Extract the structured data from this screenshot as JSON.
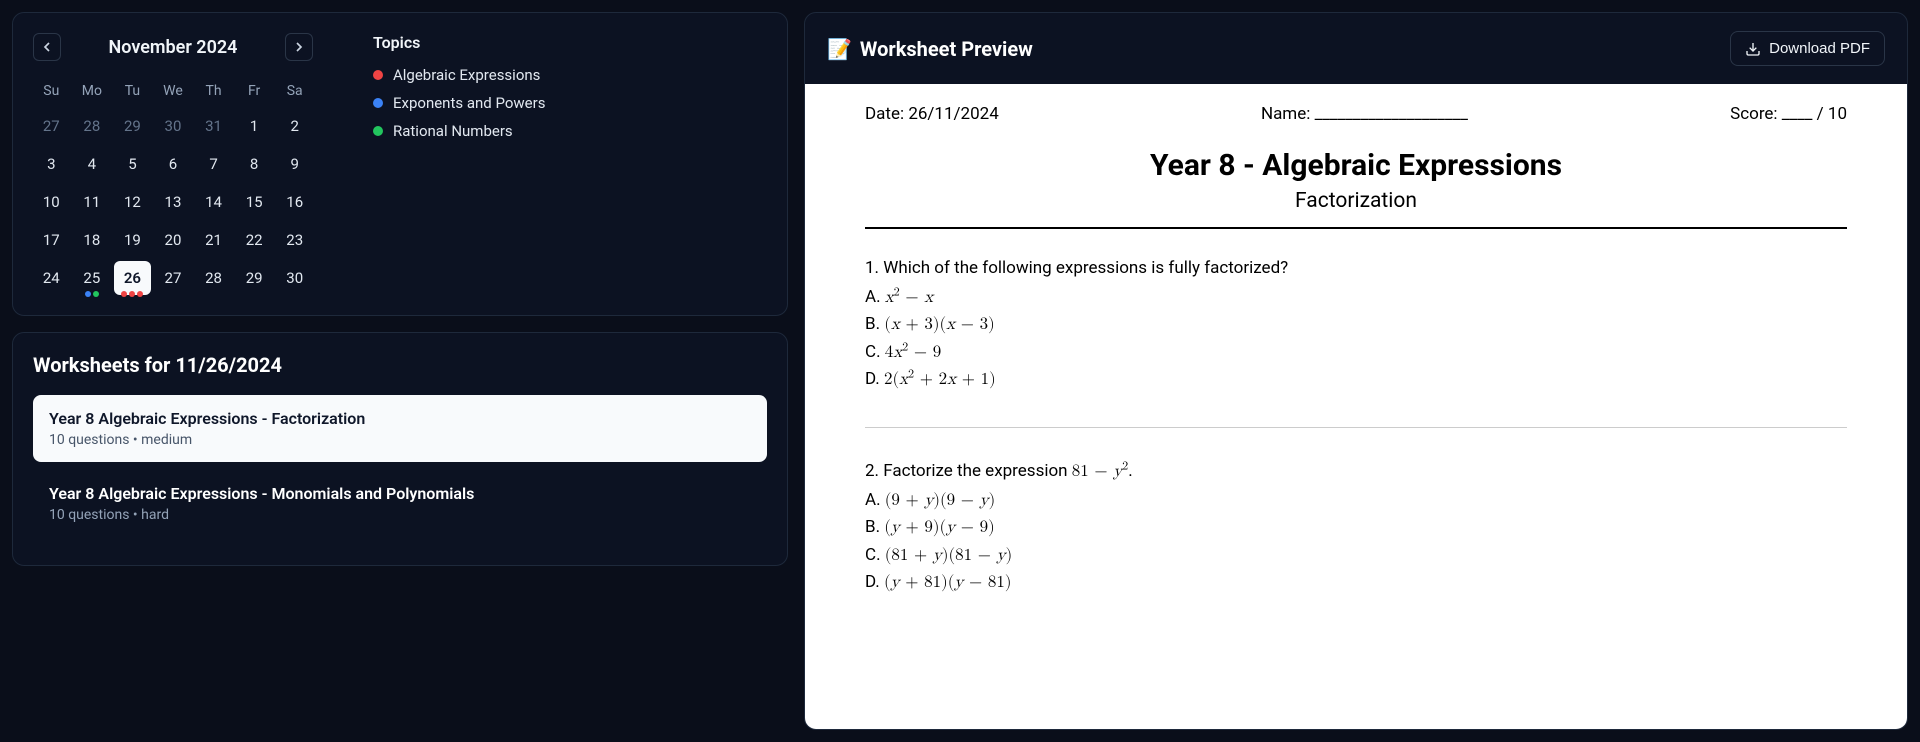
{
  "calendar": {
    "title": "November 2024",
    "dow": [
      "Su",
      "Mo",
      "Tu",
      "We",
      "Th",
      "Fr",
      "Sa"
    ],
    "prev_days": [
      "27",
      "28",
      "29",
      "30",
      "31"
    ],
    "days": [
      "1",
      "2",
      "3",
      "4",
      "5",
      "6",
      "7",
      "8",
      "9",
      "10",
      "11",
      "12",
      "13",
      "14",
      "15",
      "16",
      "17",
      "18",
      "19",
      "20",
      "21",
      "22",
      "23",
      "24",
      "25",
      "26",
      "27",
      "28",
      "29",
      "30"
    ],
    "selected": "26",
    "day_dots": {
      "25": [
        "#3b82f6",
        "#22c55e"
      ],
      "26": [
        "#ef4444",
        "#ef4444",
        "#ef4444"
      ]
    }
  },
  "topics": {
    "heading": "Topics",
    "items": [
      {
        "label": "Algebraic Expressions",
        "color": "#ef4444"
      },
      {
        "label": "Exponents and Powers",
        "color": "#3b82f6"
      },
      {
        "label": "Rational Numbers",
        "color": "#22c55e"
      }
    ]
  },
  "worksheets": {
    "heading": "Worksheets for 11/26/2024",
    "items": [
      {
        "title": "Year 8 Algebraic Expressions - Factorization",
        "meta": "10 questions  •  medium",
        "selected": true
      },
      {
        "title": "Year 8 Algebraic Expressions - Monomials and Polynomials",
        "meta": "10 questions  •  hard",
        "selected": false
      }
    ]
  },
  "preview": {
    "header_icon": "📝",
    "header_title": "Worksheet Preview",
    "download_label": "Download PDF",
    "doc": {
      "date_label": "Date: 26/11/2024",
      "name_label": "Name: ____________________",
      "score_label": "Score: ____ / 10",
      "title": "Year 8 - Algebraic Expressions",
      "subtitle": "Factorization",
      "questions": [
        {
          "text": "1. Which of the following expressions is fully factorized?",
          "options": [
            "A. <span class='math'><i>x</i><sup>2</sup> − <i>x</i></span>",
            "B. <span class='math'>(<i>x</i> + 3)(<i>x</i> − 3)</span>",
            "C. <span class='math'>4<i>x</i><sup>2</sup> − 9</span>",
            "D. <span class='math'>2(<i>x</i><sup>2</sup> + 2<i>x</i> + 1)</span>"
          ]
        },
        {
          "text": "2. Factorize the expression <span class='math'>81 − <i>y</i><sup>2</sup></span>.",
          "options": [
            "A. <span class='math'>(9 + <i>y</i>)(9 − <i>y</i>)</span>",
            "B. <span class='math'>(<i>y</i> + 9)(<i>y</i> − 9)</span>",
            "C. <span class='math'>(81 + <i>y</i>)(81 − <i>y</i>)</span>",
            "D. <span class='math'>(<i>y</i> + 81)(<i>y</i> − 81)</span>"
          ]
        }
      ]
    }
  }
}
